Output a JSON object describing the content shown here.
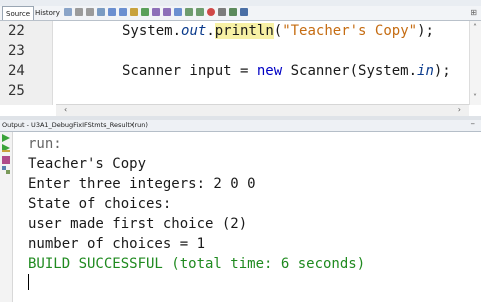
{
  "toolbar": {
    "source_tab": "Source",
    "history_tab": "History"
  },
  "editor": {
    "lines": [
      {
        "number": "22",
        "pre": "System.",
        "italic": "out",
        "dot": ".",
        "method": "println",
        "open": "(",
        "string": "\"Teacher's Copy\"",
        "close": ");"
      },
      {
        "number": "23"
      },
      {
        "number": "24",
        "pre": "Scanner input = ",
        "kw": "new",
        "mid": " Scanner(System.",
        "italic": "in",
        "close": ");"
      },
      {
        "number": "25"
      }
    ]
  },
  "output_panel": {
    "tab_label": "Output - U3A1_DebugFixIFStmts_Result (run)",
    "close_label": "×",
    "lines": [
      {
        "text": "run:",
        "color": "gray"
      },
      {
        "text": "Teacher's Copy",
        "color": "black"
      },
      {
        "text": "Enter three integers: 2 0 0",
        "color": "black"
      },
      {
        "text": "State of choices:",
        "color": "black"
      },
      {
        "text": "user made first choice (2)",
        "color": "black"
      },
      {
        "text": "number of choices = 1",
        "color": "black"
      },
      {
        "text": "BUILD SUCCESSFUL (total time: 6 seconds)",
        "color": "green"
      }
    ]
  },
  "colors": {
    "string": "#c56c12",
    "keyword": "#0000c4",
    "build_success": "#1f8a1f",
    "highlight": "#f7f1a5"
  }
}
